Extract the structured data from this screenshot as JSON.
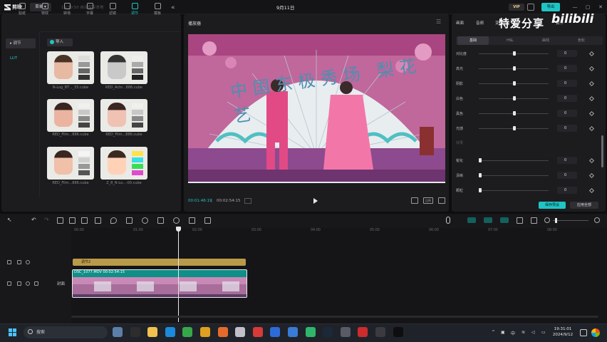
{
  "titlebar": {
    "app_name": "剪映",
    "menu_label": "菜单",
    "autosave": "19:30:50 自动保存本地",
    "date": "9月11日",
    "vip_label": "VIP",
    "publish_label": "导出"
  },
  "toolbar_tabs": [
    {
      "label": "贴纸",
      "icon": "sticker-icon"
    },
    {
      "label": "特效",
      "icon": "sparkle-icon"
    },
    {
      "label": "转场",
      "icon": "transition-icon"
    },
    {
      "label": "字幕",
      "icon": "subtitle-icon"
    },
    {
      "label": "滤镜",
      "icon": "filter-icon"
    },
    {
      "label": "调节",
      "icon": "adjust-icon"
    },
    {
      "label": "模板",
      "icon": "template-icon"
    }
  ],
  "sidebar": {
    "items": [
      {
        "label": "▸ 调节"
      },
      {
        "label": "LUT"
      }
    ]
  },
  "import_label": "导入",
  "luts": [
    {
      "label": "N-Log_BT..._33.cube"
    },
    {
      "label": "RED_Achr...886.cube"
    },
    {
      "label": "RED_Film...886.cube"
    },
    {
      "label": "RED_Film...886.cube"
    },
    {
      "label": "RED_Film...886.cube"
    },
    {
      "label": "Z_8_N-Lo...-00.cube"
    }
  ],
  "player": {
    "title": "播放器",
    "video_text": "中国东极秀场 梨花艺",
    "current_time": "00:01:46:19",
    "total_time": "00:02:54:15",
    "ratio_label": "比例"
  },
  "right_panel": {
    "tabs": [
      {
        "label": "画面"
      },
      {
        "label": "音频"
      },
      {
        "label": "变速"
      },
      {
        "label": "调节"
      }
    ],
    "watermark": "特爱分享",
    "brand": "bilibili",
    "subtabs": [
      {
        "label": "基础"
      },
      {
        "label": "HSL"
      },
      {
        "label": "曲线"
      },
      {
        "label": "色轮"
      }
    ],
    "params": [
      {
        "label": "对比度",
        "value": "0",
        "level": 0.5
      },
      {
        "label": "高光",
        "value": "0",
        "level": 0.5
      },
      {
        "label": "阴影",
        "value": "0",
        "level": 0.5
      },
      {
        "label": "白色",
        "value": "0",
        "level": 0.5
      },
      {
        "label": "黑色",
        "value": "0",
        "level": 0.5
      },
      {
        "label": "光感",
        "value": "0",
        "level": 0.5
      },
      {
        "label": "锐化",
        "value": "0",
        "level": 0.0
      },
      {
        "label": "清晰",
        "value": "0",
        "level": 0.0
      },
      {
        "label": "颗粒",
        "value": "0",
        "level": 0.0
      }
    ],
    "section_effect": "效果",
    "save_preset": "保存预设",
    "apply_all": "应用全部"
  },
  "timeline": {
    "ruler": [
      "00:00",
      "01:00",
      "02:00",
      "03:00",
      "04:00",
      "05:00",
      "06:00",
      "07:00",
      "08:00"
    ],
    "adjust_clip": "调节2",
    "video_clip": "DSC_1077.MOV  00:02:54:15",
    "cover_label": "封面"
  },
  "taskbar": {
    "search_placeholder": "搜索",
    "time": "19:31:01",
    "date": "2024/9/12",
    "tray_lang": "中"
  }
}
